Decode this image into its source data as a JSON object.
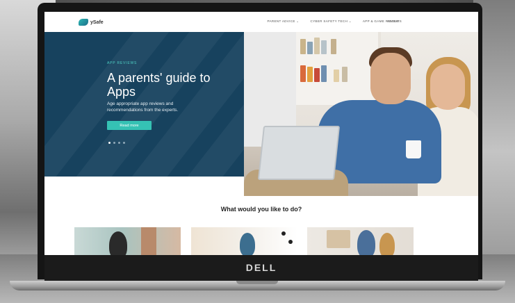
{
  "device": {
    "brand": "DELL"
  },
  "site": {
    "logo_text": "ySafe",
    "nav": [
      {
        "label": "PARENT ADVICE",
        "dropdown": true
      },
      {
        "label": "CYBER SAFETY TECH",
        "dropdown": true
      },
      {
        "label": "APP & GAME REVIEWS",
        "dropdown": false
      },
      {
        "label": "ABOUT",
        "dropdown": false
      }
    ]
  },
  "hero": {
    "eyebrow": "APP REVIEWS",
    "title": "A parents' guide to Apps",
    "subtitle": "Age appropriate app reviews and recommendations from the experts.",
    "button_label": "Read more",
    "slides": 4,
    "active_slide": 1,
    "panel_color": "#17425e",
    "accent_color": "#35c2b4"
  },
  "section": {
    "title": "What would you like to do?"
  },
  "cards": [
    {
      "image": "child-photo"
    },
    {
      "image": "man-photo"
    },
    {
      "image": "family-photo"
    }
  ]
}
